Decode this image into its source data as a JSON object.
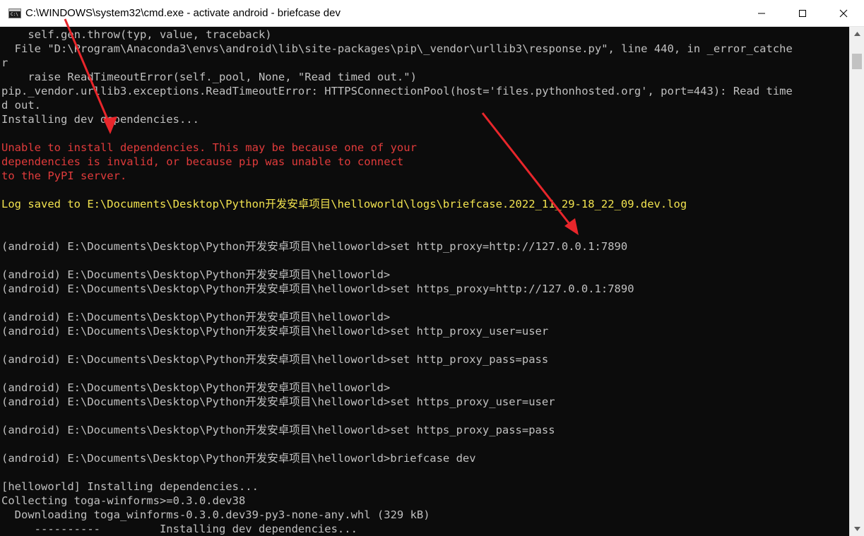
{
  "window": {
    "title": "C:\\WINDOWS\\system32\\cmd.exe - activate  android - briefcase  dev",
    "icon": "cmd-icon",
    "controls": [
      "minimize-icon",
      "maximize-icon",
      "close-icon"
    ]
  },
  "console": {
    "lines": [
      {
        "text": "    self.gen.throw(typ, value, traceback)",
        "color": "default"
      },
      {
        "text": "  File \"D:\\Program\\Anaconda3\\envs\\android\\lib\\site-packages\\pip\\_vendor\\urllib3\\response.py\", line 440, in _error_catche",
        "color": "default"
      },
      {
        "text": "r",
        "color": "default"
      },
      {
        "text": "    raise ReadTimeoutError(self._pool, None, \"Read timed out.\")",
        "color": "default"
      },
      {
        "text": "pip._vendor.urllib3.exceptions.ReadTimeoutError: HTTPSConnectionPool(host='files.pythonhosted.org', port=443): Read time",
        "color": "default"
      },
      {
        "text": "d out.",
        "color": "default"
      },
      {
        "text": "Installing dev dependencies...",
        "color": "default"
      },
      {
        "text": "",
        "color": "default"
      },
      {
        "text": "Unable to install dependencies. This may be because one of your",
        "color": "red"
      },
      {
        "text": "dependencies is invalid, or because pip was unable to connect",
        "color": "red"
      },
      {
        "text": "to the PyPI server.",
        "color": "red"
      },
      {
        "text": "",
        "color": "default"
      },
      {
        "text": "Log saved to E:\\Documents\\Desktop\\Python开发安卓项目\\helloworld\\logs\\briefcase.2022_11_29-18_22_09.dev.log",
        "color": "yellow"
      },
      {
        "text": "",
        "color": "default"
      },
      {
        "text": "",
        "color": "default"
      },
      {
        "text": "(android) E:\\Documents\\Desktop\\Python开发安卓项目\\helloworld>set http_proxy=http://127.0.0.1:7890",
        "color": "default"
      },
      {
        "text": "",
        "color": "default"
      },
      {
        "text": "(android) E:\\Documents\\Desktop\\Python开发安卓项目\\helloworld>",
        "color": "default"
      },
      {
        "text": "(android) E:\\Documents\\Desktop\\Python开发安卓项目\\helloworld>set https_proxy=http://127.0.0.1:7890",
        "color": "default"
      },
      {
        "text": "",
        "color": "default"
      },
      {
        "text": "(android) E:\\Documents\\Desktop\\Python开发安卓项目\\helloworld>",
        "color": "default"
      },
      {
        "text": "(android) E:\\Documents\\Desktop\\Python开发安卓项目\\helloworld>set http_proxy_user=user",
        "color": "default"
      },
      {
        "text": "",
        "color": "default"
      },
      {
        "text": "(android) E:\\Documents\\Desktop\\Python开发安卓项目\\helloworld>set http_proxy_pass=pass",
        "color": "default"
      },
      {
        "text": "",
        "color": "default"
      },
      {
        "text": "(android) E:\\Documents\\Desktop\\Python开发安卓项目\\helloworld>",
        "color": "default"
      },
      {
        "text": "(android) E:\\Documents\\Desktop\\Python开发安卓项目\\helloworld>set https_proxy_user=user",
        "color": "default"
      },
      {
        "text": "",
        "color": "default"
      },
      {
        "text": "(android) E:\\Documents\\Desktop\\Python开发安卓项目\\helloworld>set https_proxy_pass=pass",
        "color": "default"
      },
      {
        "text": "",
        "color": "default"
      },
      {
        "text": "(android) E:\\Documents\\Desktop\\Python开发安卓项目\\helloworld>briefcase dev",
        "color": "default"
      },
      {
        "text": "",
        "color": "default"
      },
      {
        "text": "[helloworld] Installing dependencies...",
        "color": "default"
      },
      {
        "text": "Collecting toga-winforms>=0.3.0.dev38",
        "color": "default"
      },
      {
        "text": "  Downloading toga_winforms-0.3.0.dev39-py3-none-any.whl (329 kB)",
        "color": "default"
      },
      {
        "text": "     ----------         Installing dev dependencies...",
        "color": "default"
      }
    ]
  },
  "colors": {
    "console_bg": "#0c0c0c",
    "text_default": "#c0c0c0",
    "text_error": "#e13b3b",
    "text_log": "#f2e34f",
    "annotation_arrow": "#e8262b"
  },
  "annotations": {
    "arrow_count": 2,
    "icon": "red-arrow-icon"
  }
}
